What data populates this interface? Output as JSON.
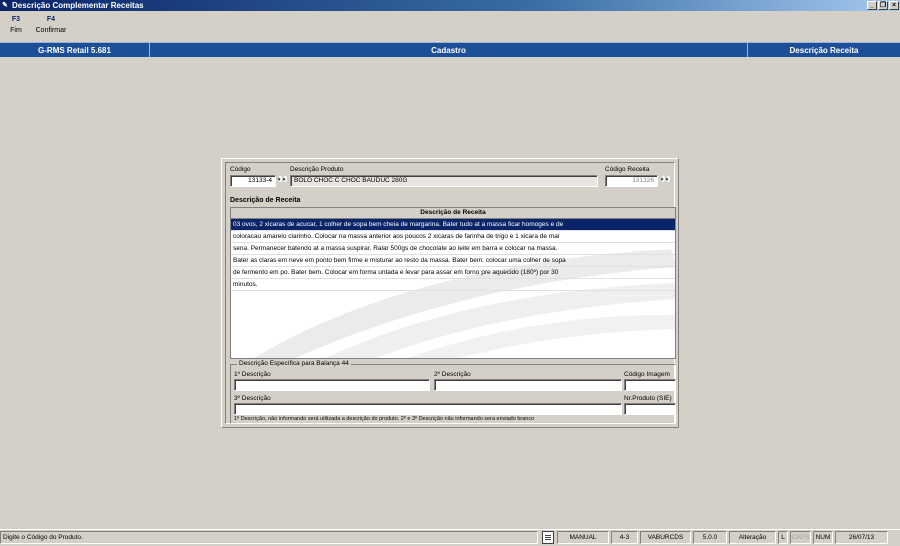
{
  "window": {
    "title": "Descrição Complementar Receitas",
    "controls": [
      "minimize",
      "restore",
      "close"
    ]
  },
  "function_keys": [
    {
      "key": "F3",
      "label": "Fim"
    },
    {
      "key": "F4",
      "label": "Confirmar"
    }
  ],
  "infobar": {
    "system": "G-RMS Retail 5.681",
    "module": "Cadastro",
    "screen": "Descrição Receita"
  },
  "form": {
    "codigo_label": "Código",
    "codigo_value": "13133-4",
    "descricao_produto_label": "Descrição Produto",
    "descricao_produto_value": "BOLO CHOC C CHOC BAUDUC 280G",
    "codigo_receita_label": "Código Receita",
    "codigo_receita_value": "131326",
    "search_icon": "binoculars-icon"
  },
  "recipe": {
    "section_title": "Descrição de Receita",
    "column_header": "Descrição de Receita",
    "lines": [
      "03 ovos, 2 xicaras de acucar, 1 colher de sopa bem cheia de margarina. Bater tudo at a massa ficar homoges e de",
      "coloracao amarelo clarinho. Colocar na massa anterior aos poucos 2 xicaras de farinha de trigo e 1 xicara de mai",
      "sena. Permanecer batendo at a massa suspirar. Ralar 500gs de chocolate ao leite em barra e colocar na massa.",
      "Bater as claras em neve em ponto bem firme  e misturar ao resto da massa. Bater bem. colocar uma colher de sopa",
      "de fermento em po. Bater bem. Colocar em forma untada  e levar para assar em forno pre aquecido (180º) por 30",
      "minutos."
    ],
    "selected_line": 0
  },
  "balanca": {
    "group_title": "Descrição Específica para Balança 44",
    "desc1_label": "1º Descrição",
    "desc1_value": "",
    "desc2_label": "2º Descrição",
    "desc2_value": "",
    "desc3_label": "3º Descrição",
    "desc3_value": "",
    "codigo_imagem_label": "Código Imagem",
    "codigo_imagem_value": "",
    "nr_produto_label": "Nr.Produto (SIE)",
    "nr_produto_value": "",
    "note": "1º Descrição, não informando será utilizada a descrição do produto. 2º e 3º Descrição não informando sera enviado branco"
  },
  "statusbar": {
    "message": "Digite o Código do Produto.",
    "mode": "MANUAL",
    "code": "4-3",
    "user": "VABURCDS",
    "version": "5.0.0",
    "operation": "Alteração",
    "l": "L",
    "caps": "CAPS",
    "num": "NUM",
    "date": "26/07/13"
  }
}
